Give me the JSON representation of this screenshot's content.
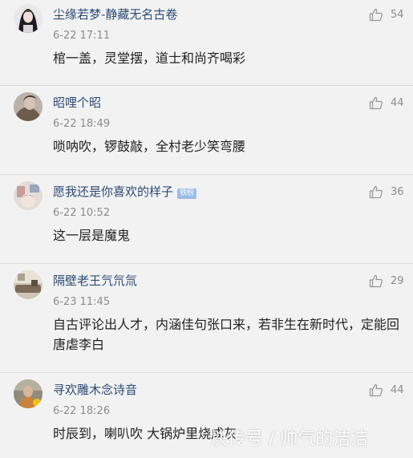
{
  "comments": [
    {
      "username": "尘缘若梦-静藏无名古卷",
      "time": "6-22 17:11",
      "text": "棺一盖，灵堂摆，道士和尚齐喝彩",
      "likes": "54",
      "badge": "",
      "avatar_icon": "avatar-girl-icon"
    },
    {
      "username": "昭哩个昭",
      "time": "6-22 18:49",
      "text": "唢呐吹，锣鼓敲，全村老少笑弯腰",
      "likes": "44",
      "badge": "",
      "avatar_icon": "avatar-portrait-icon"
    },
    {
      "username": "愿我还是你喜欢的样子",
      "time": "6-22 10:52",
      "text": "这一层是魔鬼",
      "likes": "36",
      "badge": "铁粉",
      "avatar_icon": "avatar-photo-icon"
    },
    {
      "username": "隔壁老王氕氘氚",
      "time": "6-23 11:45",
      "text": "自古评论出人才，内涵佳句张口来，若非生在新时代，定能回唐虐李白",
      "likes": "29",
      "badge": "",
      "avatar_icon": "avatar-room-icon"
    },
    {
      "username": "寻欢雕木念诗音",
      "time": "6-22 18:26",
      "text": "时辰到，喇叭吹 大锅炉里烧成灰",
      "likes": "44",
      "badge": "",
      "avatar_icon": "avatar-person-icon"
    }
  ],
  "watermark": "快传号 / 帅气的洁洁",
  "colors": {
    "background": "#f2f2f2",
    "username": "#2c4a73",
    "meta": "#8c8c8c",
    "text": "#222222",
    "badge": "#9bbce8"
  }
}
